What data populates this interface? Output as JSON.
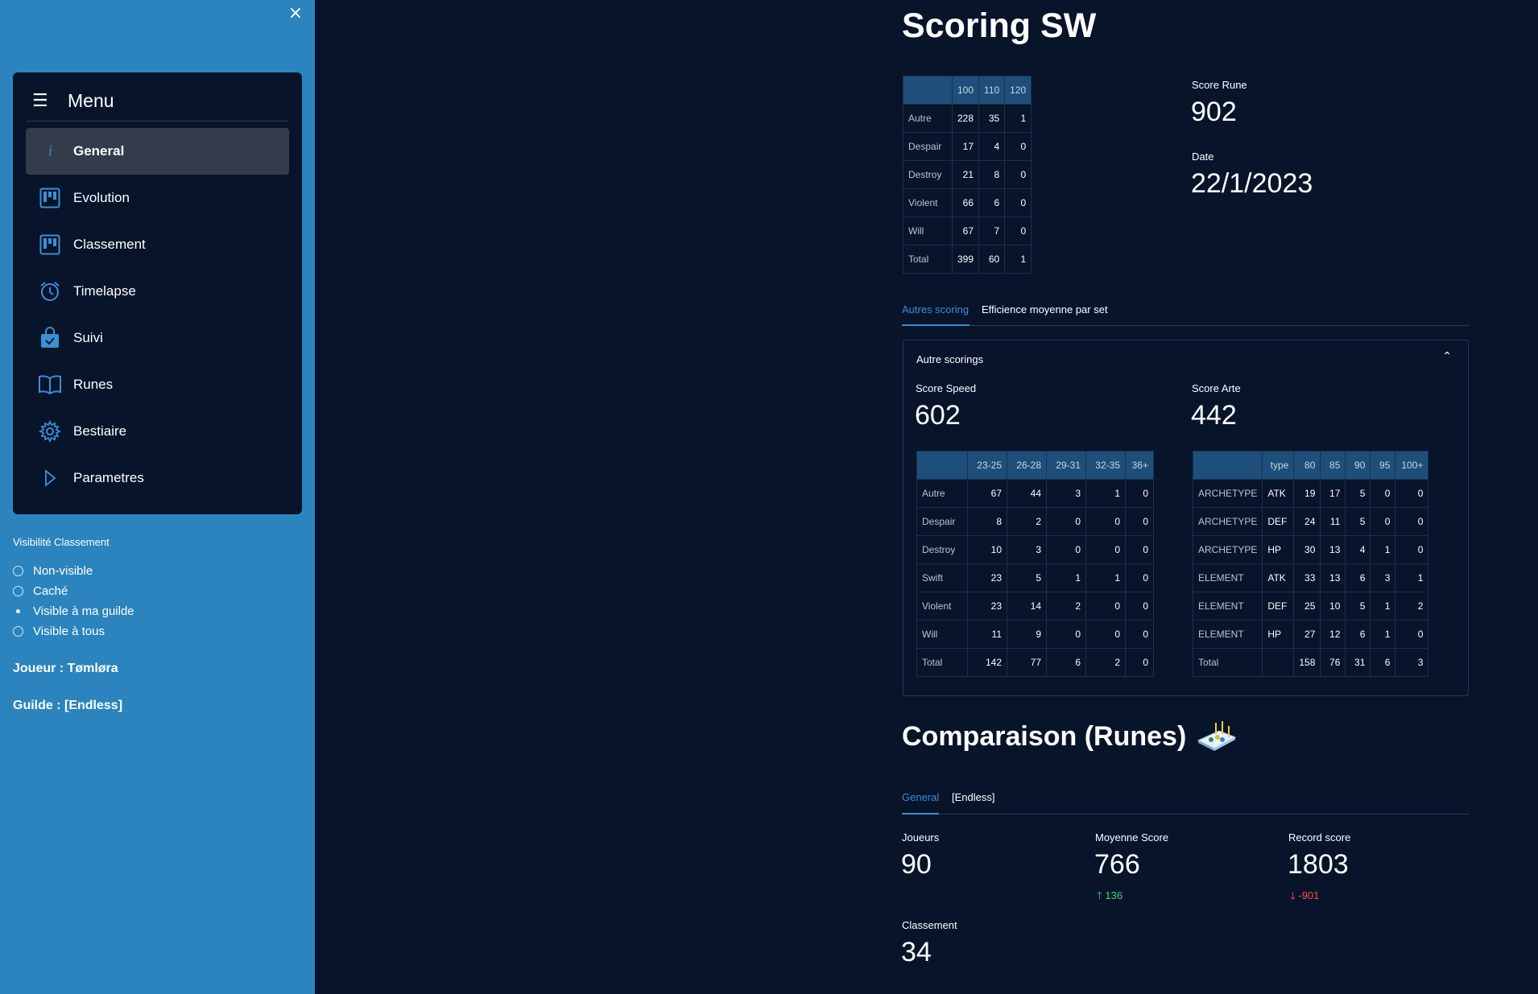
{
  "sidebar": {
    "close_icon": "×",
    "menu_title": "Menu",
    "menu_icon": "☰",
    "items": [
      {
        "label": "General",
        "icon": "info-icon",
        "active": true
      },
      {
        "label": "Evolution",
        "icon": "kanban-icon"
      },
      {
        "label": "Classement",
        "icon": "kanban-icon"
      },
      {
        "label": "Timelapse",
        "icon": "alarm-icon"
      },
      {
        "label": "Suivi",
        "icon": "bag-check-icon"
      },
      {
        "label": "Runes",
        "icon": "book-icon"
      },
      {
        "label": "Bestiaire",
        "icon": "gear-icon"
      },
      {
        "label": "Parametres",
        "icon": "play-icon"
      }
    ],
    "visibility": {
      "title": "Visibilité Classement",
      "options": [
        "Non-visible",
        "Caché",
        "Visible à ma guilde",
        "Visible à tous"
      ],
      "selected": "Visible à ma guilde"
    },
    "player": "Joueur : Tømløra",
    "guild": "Guilde : [Endless]"
  },
  "main": {
    "title": "Scoring SW",
    "rune_table": {
      "columns": [
        "",
        "100",
        "110",
        "120"
      ],
      "rows": [
        [
          "Autre",
          "228",
          "35",
          "1"
        ],
        [
          "Despair",
          "17",
          "4",
          "0"
        ],
        [
          "Destroy",
          "21",
          "8",
          "0"
        ],
        [
          "Violent",
          "66",
          "6",
          "0"
        ],
        [
          "Will",
          "67",
          "7",
          "0"
        ],
        [
          "Total",
          "399",
          "60",
          "1"
        ]
      ]
    },
    "score_rune": {
      "label": "Score Rune",
      "value": "902"
    },
    "date": {
      "label": "Date",
      "value": "22/1/2023"
    },
    "tabs": [
      "Autres scoring",
      "Efficience moyenne par set"
    ],
    "expander": {
      "title": "Autre scorings",
      "score_speed": {
        "label": "Score Speed",
        "value": "602"
      },
      "score_arte": {
        "label": "Score Arte",
        "value": "442"
      },
      "speed_table": {
        "columns": [
          "",
          "23-25",
          "26-28",
          "29-31",
          "32-35",
          "36+"
        ],
        "rows": [
          [
            "Autre",
            "67",
            "44",
            "3",
            "1",
            "0"
          ],
          [
            "Despair",
            "8",
            "2",
            "0",
            "0",
            "0"
          ],
          [
            "Destroy",
            "10",
            "3",
            "0",
            "0",
            "0"
          ],
          [
            "Swift",
            "23",
            "5",
            "1",
            "1",
            "0"
          ],
          [
            "Violent",
            "23",
            "14",
            "2",
            "0",
            "0"
          ],
          [
            "Will",
            "11",
            "9",
            "0",
            "0",
            "0"
          ],
          [
            "Total",
            "142",
            "77",
            "6",
            "2",
            "0"
          ]
        ]
      },
      "arte_table": {
        "columns": [
          "",
          "type",
          "80",
          "85",
          "90",
          "95",
          "100+"
        ],
        "rows": [
          [
            "ARCHETYPE",
            "ATK",
            "19",
            "17",
            "5",
            "0",
            "0"
          ],
          [
            "ARCHETYPE",
            "DEF",
            "24",
            "11",
            "5",
            "0",
            "0"
          ],
          [
            "ARCHETYPE",
            "HP",
            "30",
            "13",
            "4",
            "1",
            "0"
          ],
          [
            "ELEMENT",
            "ATK",
            "33",
            "13",
            "6",
            "3",
            "1"
          ],
          [
            "ELEMENT",
            "DEF",
            "25",
            "10",
            "5",
            "1",
            "2"
          ],
          [
            "ELEMENT",
            "HP",
            "27",
            "12",
            "6",
            "1",
            "0"
          ],
          [
            "Total",
            "",
            "158",
            "76",
            "31",
            "6",
            "3"
          ]
        ]
      }
    },
    "comparison": {
      "title": "Comparaison (Runes)",
      "tabs": [
        "General",
        "[Endless]"
      ],
      "joueurs": {
        "label": "Joueurs",
        "value": "90"
      },
      "moyenne": {
        "label": "Moyenne Score",
        "value": "766",
        "delta": "136"
      },
      "record": {
        "label": "Record score",
        "value": "1803",
        "delta": "-901"
      },
      "classement": {
        "label": "Classement",
        "value": "34"
      }
    }
  },
  "colors": {
    "sidebar_bg": "#2b84bd",
    "main_bg": "#07142a",
    "accent": "#3b8fd4",
    "delta_up": "#3dd56d",
    "delta_down": "#ff4b4b",
    "table_header": "#1d4f7a"
  }
}
